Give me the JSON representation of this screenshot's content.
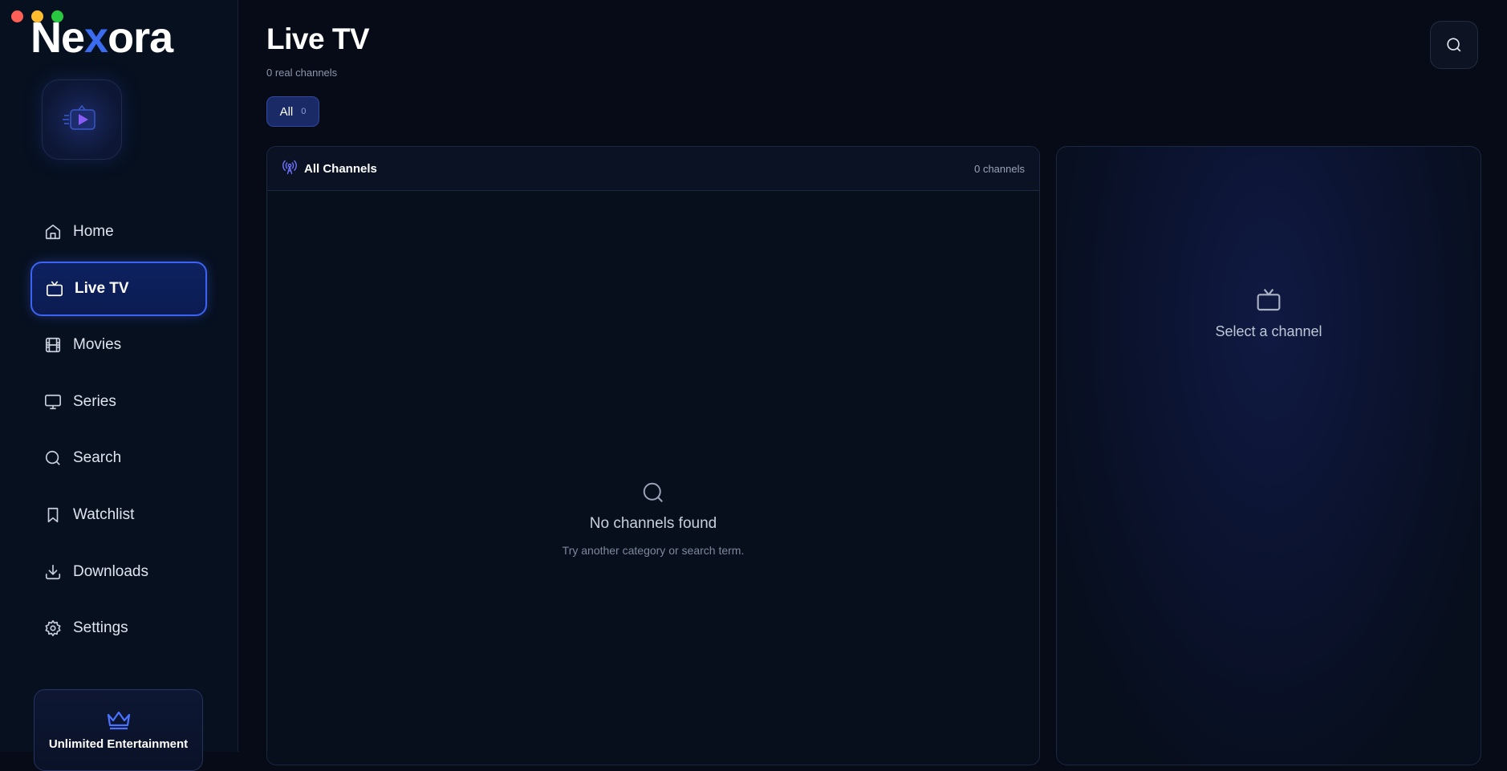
{
  "app": {
    "name_part1": "Ne",
    "name_x": "x",
    "name_part2": "ora"
  },
  "sidebar": {
    "items": [
      {
        "label": "Home",
        "icon": "home-icon",
        "active": false
      },
      {
        "label": "Live TV",
        "icon": "tv-icon",
        "active": true
      },
      {
        "label": "Movies",
        "icon": "film-icon",
        "active": false
      },
      {
        "label": "Series",
        "icon": "monitor-icon",
        "active": false
      },
      {
        "label": "Search",
        "icon": "search-icon",
        "active": false
      },
      {
        "label": "Watchlist",
        "icon": "bookmark-icon",
        "active": false
      },
      {
        "label": "Downloads",
        "icon": "download-icon",
        "active": false
      },
      {
        "label": "Settings",
        "icon": "gear-icon",
        "active": false
      }
    ],
    "promo": {
      "title": "Unlimited Entertainment",
      "icon": "crown-icon"
    }
  },
  "main": {
    "title": "Live TV",
    "subtitle": "0 real channels",
    "chips": [
      {
        "label": "All",
        "count": "0"
      }
    ],
    "channels_panel": {
      "title": "All Channels",
      "count": "0 channels",
      "icon": "broadcast-icon"
    },
    "empty": {
      "title": "No channels found",
      "hint": "Try another category or search term."
    },
    "preview": {
      "text": "Select a channel",
      "icon": "tv-icon"
    }
  },
  "colors": {
    "accent": "#3c63f5",
    "background": "#060b17",
    "purple": "#7b4df0"
  }
}
